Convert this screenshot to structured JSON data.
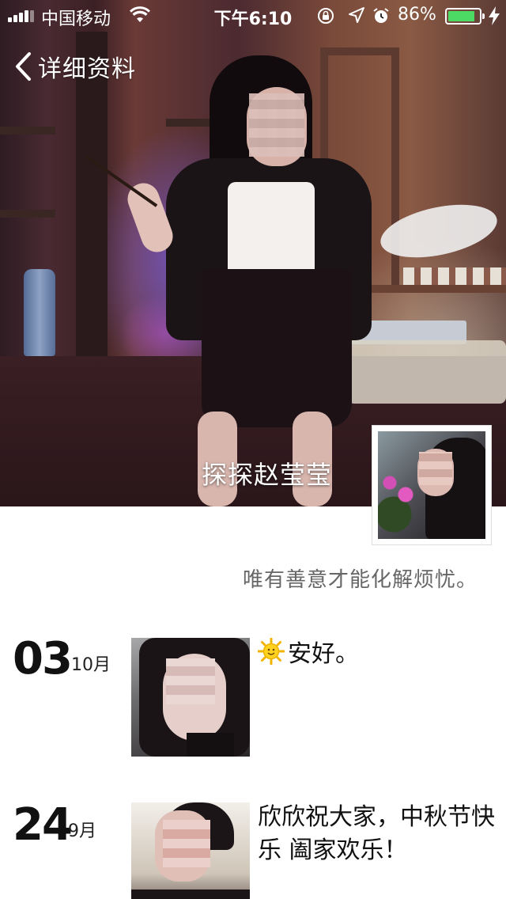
{
  "status_bar": {
    "carrier": "中国移动",
    "time": "下午6:10",
    "battery_percent": "86%",
    "battery_level": 0.86,
    "icons": [
      "signal-icon",
      "wifi-icon",
      "orientation-lock-icon",
      "location-icon",
      "alarm-icon",
      "battery-icon",
      "charging-bolt-icon"
    ]
  },
  "nav": {
    "back_label": "详细资料"
  },
  "profile": {
    "cover_name": "探探赵莹莹",
    "signature": "唯有善意才能化解烦忧。"
  },
  "posts": [
    {
      "day": "03",
      "month": "10月",
      "text": "安好。",
      "emoji": "sun-emoji"
    },
    {
      "day": "24",
      "month": "9月",
      "text": "欣欣祝大家，中秋节快乐 阖家欢乐！"
    }
  ],
  "colors": {
    "battery_fill": "#4cd964",
    "signature_text": "#666666"
  }
}
